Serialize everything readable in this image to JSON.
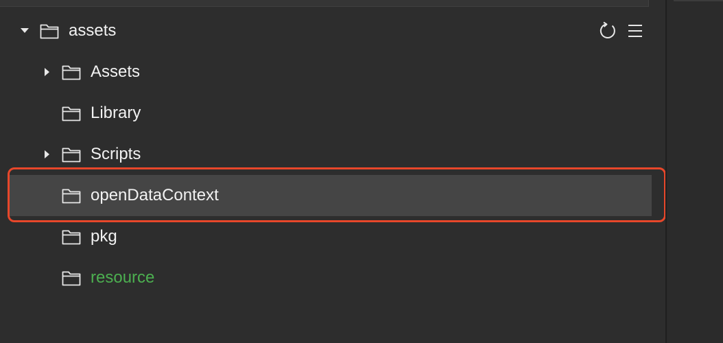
{
  "tree": {
    "root": {
      "label": "assets",
      "expanded": true,
      "icon": "folder-icon"
    },
    "items": [
      {
        "label": "Assets",
        "has_children": true,
        "expanded": false,
        "color": "#f2f2f2"
      },
      {
        "label": "Library",
        "has_children": false,
        "color": "#f2f2f2"
      },
      {
        "label": "Scripts",
        "has_children": true,
        "expanded": false,
        "color": "#f2f2f2"
      },
      {
        "label": "openDataContext",
        "has_children": false,
        "selected": true,
        "color": "#f2f2f2"
      },
      {
        "label": "pkg",
        "has_children": false,
        "color": "#f2f2f2"
      },
      {
        "label": "resource",
        "has_children": false,
        "color": "#4caf50"
      }
    ]
  },
  "toolbar": {
    "refresh_icon": "refresh-icon",
    "menu_icon": "hamburger-menu-icon"
  },
  "colors": {
    "background": "#2d2d2d",
    "selected_row": "#454545",
    "highlight_border": "#e8472a",
    "text": "#f2f2f2",
    "green_text": "#4caf50"
  }
}
